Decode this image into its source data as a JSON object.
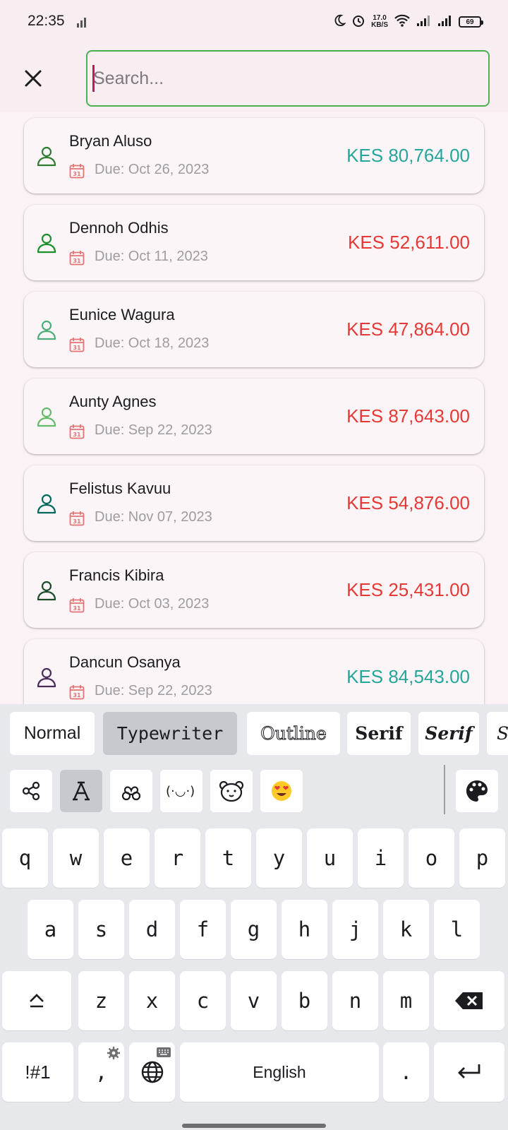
{
  "status_bar": {
    "time": "22:35",
    "speed_value": "17.0",
    "speed_unit": "KB/S",
    "battery": "69"
  },
  "search": {
    "placeholder": "Search...",
    "value": ""
  },
  "debtors": [
    {
      "name": "Bryan Aluso",
      "due": "Due: Oct 26, 2023",
      "amount": "KES 80,764.00",
      "amount_color": "#26a69a",
      "icon_color": "#2e7d32"
    },
    {
      "name": "Dennoh Odhis",
      "due": "Due: Oct 11, 2023",
      "amount": "KES 52,611.00",
      "amount_color": "#e53935",
      "icon_color": "#1b8f2a"
    },
    {
      "name": "Eunice Wagura",
      "due": "Due: Oct 18, 2023",
      "amount": "KES 47,864.00",
      "amount_color": "#e53935",
      "icon_color": "#4caf7a"
    },
    {
      "name": "Aunty Agnes",
      "due": "Due: Sep 22, 2023",
      "amount": "KES 87,643.00",
      "amount_color": "#e53935",
      "icon_color": "#66bb6a"
    },
    {
      "name": "Felistus Kavuu",
      "due": "Due: Nov 07, 2023",
      "amount": "KES 54,876.00",
      "amount_color": "#e53935",
      "icon_color": "#00695c"
    },
    {
      "name": "Francis Kibira",
      "due": "Due: Oct 03, 2023",
      "amount": "KES 25,431.00",
      "amount_color": "#e53935",
      "icon_color": "#1b4d2a"
    },
    {
      "name": "Dancun Osanya",
      "due": "Due: Sep 22, 2023",
      "amount": "KES 84,543.00",
      "amount_color": "#26a69a",
      "icon_color": "#4a2c5a"
    }
  ],
  "keyboard": {
    "font_styles": [
      "Normal",
      "Typewriter",
      "Outline",
      "Serif",
      "Serif",
      "S"
    ],
    "active_font_style": "Typewriter",
    "row1": [
      "q",
      "w",
      "e",
      "r",
      "t",
      "y",
      "u",
      "i",
      "o",
      "p"
    ],
    "row2": [
      "a",
      "s",
      "d",
      "f",
      "g",
      "h",
      "j",
      "k",
      "l"
    ],
    "row3": [
      "z",
      "x",
      "c",
      "v",
      "b",
      "n",
      "m"
    ],
    "symbols_label": "!#1",
    "comma": ",",
    "space_label": "English",
    "period": "."
  },
  "colors": {
    "search_border": "#4caf50",
    "calendar_icon": "#e57373",
    "negative_amount": "#e53935",
    "positive_amount": "#26a69a"
  }
}
